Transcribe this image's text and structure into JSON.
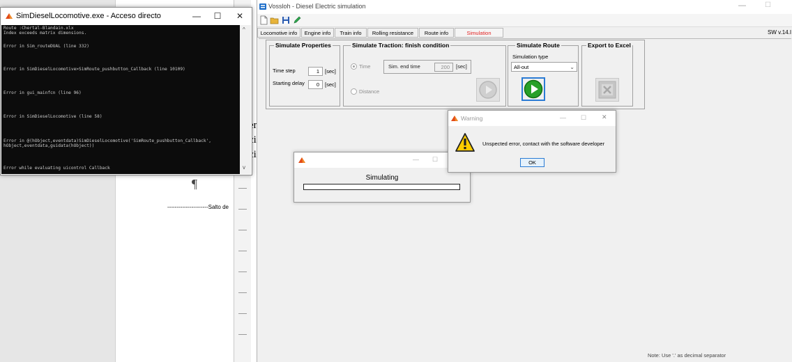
{
  "word_doc": {
    "fragment_1": "er",
    "fragment_2": "ci",
    "fragment_3": "ci",
    "pilcrow": "¶",
    "page_break": "----------------------Salto de"
  },
  "console": {
    "title": "SimDieselLocomotive.exe - Acceso directo",
    "controls": {
      "minimize": "—",
      "maximize": "☐",
      "close": "✕"
    },
    "lines": [
      "Route :Chertal-Blandain.xlx",
      "Index exceeds matrix dimensions.",
      "Error in Sim_routeDUAL (line 332)",
      "Error in SimDieselLocomotive>SimRoute_pushbutton_Callback (line 10109)",
      "Error in gui_mainfcn (line 96)",
      "Error in SimDieselLocomotive (line 58)",
      "Error in @(hObject,eventdata)SimDieselLocomotive('SimRoute_pushbutton_Callback',",
      "hObject,eventdata,guidata(hObject))",
      "Error while evaluating uicontrol Callback"
    ]
  },
  "main": {
    "title": "Vossloh - Diesel Electric simulation",
    "controls": {
      "minimize": "—",
      "maximize": "☐"
    },
    "sw_version": "SW v.14.I",
    "note": "Note: Use '.' as decimal separator",
    "tabs": [
      {
        "label": "Locomotive info",
        "active": false
      },
      {
        "label": "Engine info",
        "active": false
      },
      {
        "label": "Train info",
        "active": false
      },
      {
        "label": "Rolling resistance",
        "active": false
      },
      {
        "label": "Route info",
        "active": false
      },
      {
        "label": "Simulation",
        "active": true
      }
    ],
    "simulate_properties": {
      "title": "Simulate Properties",
      "time_step_label": "Time step",
      "time_step_value": "1",
      "time_step_unit": "[sec]",
      "starting_delay_label": "Starting delay",
      "starting_delay_value": "0",
      "starting_delay_unit": "[sec]"
    },
    "traction": {
      "title": "Simulate Traction: finish condition",
      "time_radio": "Time",
      "sim_end_label": "Sim. end time",
      "sim_end_value": "200",
      "sim_end_unit": "[sec]",
      "distance_radio": "Distance"
    },
    "route": {
      "title": "Simulate Route",
      "type_label": "Simulation type",
      "type_value": "All-out"
    },
    "excel": {
      "title": "Export to Excel"
    }
  },
  "simulating_dialog": {
    "controls": {
      "minimize": "—",
      "maximize": "☐"
    },
    "label": "Simulating",
    "progress": 0
  },
  "warning_dialog": {
    "title": "Warning",
    "controls": {
      "minimize": "—",
      "maximize": "☐",
      "close": "✕"
    },
    "message": "Unspected error, contact with the software developer",
    "ok_label": "OK"
  },
  "colors": {
    "active_tab": "#e02020",
    "play_green": "#28a028",
    "warning_yellow": "#ffcc00",
    "console_bg": "#0c0c0c"
  }
}
